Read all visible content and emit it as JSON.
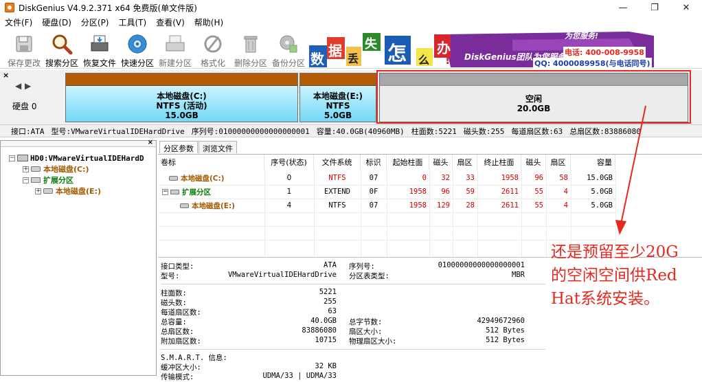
{
  "window": {
    "title": "DiskGenius V4.9.2.371 x64 免费版(单文件版)",
    "buttons": [
      "—",
      "❐",
      "✕"
    ]
  },
  "menu": [
    "文件(F)",
    "硬盘(D)",
    "分区(P)",
    "工具(T)",
    "查看(V)",
    "帮助(H)"
  ],
  "toolbar": [
    {
      "label": "保存更改",
      "icon": "save-icon",
      "enabled": false
    },
    {
      "label": "搜索分区",
      "icon": "search-magnifier-icon",
      "enabled": true
    },
    {
      "label": "恢复文件",
      "icon": "recover-files-icon",
      "enabled": true
    },
    {
      "label": "快速分区",
      "icon": "quick-partition-disc-icon",
      "enabled": true
    },
    {
      "label": "新建分区",
      "icon": "new-partition-icon",
      "enabled": false
    },
    {
      "label": "格式化",
      "icon": "format-icon",
      "enabled": false
    },
    {
      "label": "删除分区",
      "icon": "delete-partition-trash-icon",
      "enabled": false
    },
    {
      "label": "备份分区",
      "icon": "backup-partition-icon",
      "enabled": false
    }
  ],
  "banner": {
    "chars": [
      "数",
      "据",
      "丢",
      "失",
      "怎",
      "么",
      "办"
    ],
    "exclaim": "!",
    "team": "DiskGenius团队为您服务",
    "phone": "电话: 400-008-9958",
    "qq": "QQ: 4000089958(与电话同号)",
    "tagline": "为您服务!"
  },
  "diskmap": {
    "disk_label": "硬盘 0",
    "partitions": [
      {
        "name": "本地磁盘(C:)",
        "fs": "NTFS (活动)",
        "size": "15.0GB"
      },
      {
        "name": "本地磁盘(E:)",
        "fs": "NTFS",
        "size": "5.0GB"
      },
      {
        "name": "空闲",
        "size": "20.0GB"
      }
    ]
  },
  "diskinfo": [
    "接口:ATA",
    "型号:VMwareVirtualIDEHardDrive",
    "序列号:01000000000000000001",
    "容量:40.0GB(40960MB)",
    "柱面数:5221",
    "磁头数:255",
    "每道扇区数:63",
    "总扇区数:83886080"
  ],
  "tree": {
    "disk": "HD0:VMwareVirtualIDEHardD",
    "c": "本地磁盘(C:)",
    "ext": "扩展分区",
    "e": "本地磁盘(E:)"
  },
  "tabs": [
    "分区参数",
    "浏览文件"
  ],
  "table": {
    "headers": [
      "卷标",
      "序号(状态)",
      "文件系统",
      "标识",
      "起始柱面",
      "磁头",
      "扇区",
      "终止柱面",
      "磁头",
      "扇区",
      "容量"
    ],
    "rows": [
      [
        "本地磁盘(C:)",
        "0",
        "NTFS",
        "07",
        "0",
        "32",
        "33",
        "1958",
        "96",
        "58",
        "15.0GB"
      ],
      [
        "扩展分区",
        "1",
        "EXTEND",
        "0F",
        "1958",
        "96",
        "59",
        "2611",
        "55",
        "4",
        "5.0GB"
      ],
      [
        "本地磁盘(E:)",
        "4",
        "NTFS",
        "07",
        "1958",
        "129",
        "28",
        "2611",
        "55",
        "4",
        "5.0GB"
      ]
    ]
  },
  "details": {
    "iface_label": "接口类型:",
    "iface": "ATA",
    "serial_label": "序列号:",
    "serial": "01000000000000000001",
    "model_label": "型号:",
    "model": "VMwareVirtualIDEHardDrive",
    "ptype_label": "分区表类型:",
    "ptype": "MBR",
    "cyl_label": "柱面数:",
    "cyl": "5221",
    "heads_label": "磁头数:",
    "heads": "255",
    "spt_label": "每道扇区数:",
    "spt": "63",
    "cap_label": "总容量:",
    "cap": "40.0GB",
    "bytes_label": "总字节数:",
    "bytes": "42949672960",
    "sectors_label": "总扇区数:",
    "sectors": "83886080",
    "secsize_label": "扇区大小:",
    "secsize": "512 Bytes",
    "extra_label": "附加扇区数:",
    "extra": "10715",
    "physsec_label": "物理扇区大小:",
    "physsec": "512 Bytes",
    "smart_label": "S.M.A.R.T. 信息:",
    "cache_label": "缓冲区大小:",
    "cache": "32 KB",
    "mode_label": "传输模式:",
    "mode": "UDMA/33 | UDMA/33"
  },
  "annotation": [
    "还是预留至少20G",
    "的空闲空间供Red",
    "Hat系统安装。"
  ],
  "colors": {
    "partition_bar": "#b35b06",
    "partition_body": "#72d7f6",
    "annotation": "#e8281e",
    "accent_red": "#cc0000",
    "accent_green": "#0a7d0a"
  }
}
